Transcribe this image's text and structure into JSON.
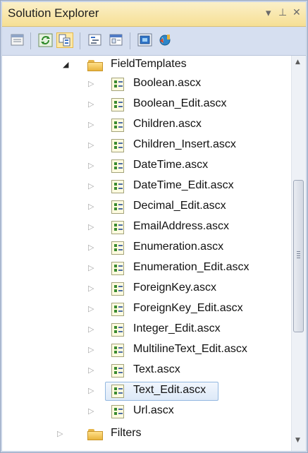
{
  "panel": {
    "title": "Solution Explorer",
    "controls": {
      "dropdown_glyph": "▾",
      "pin_glyph": "⊥",
      "close_glyph": "✕"
    }
  },
  "toolbar": {
    "buttons": [
      {
        "name": "properties-icon"
      },
      {
        "name": "refresh-icon"
      },
      {
        "name": "show-all-files-icon"
      },
      {
        "name": "view-code-icon"
      },
      {
        "name": "view-designer-icon"
      },
      {
        "name": "class-diagram-icon"
      },
      {
        "name": "copy-website-icon"
      }
    ]
  },
  "tree": {
    "folder": {
      "label": "FieldTemplates",
      "expander": "◢",
      "expanded": true
    },
    "files": [
      {
        "label": "Boolean.ascx"
      },
      {
        "label": "Boolean_Edit.ascx"
      },
      {
        "label": "Children.ascx"
      },
      {
        "label": "Children_Insert.ascx"
      },
      {
        "label": "DateTime.ascx"
      },
      {
        "label": "DateTime_Edit.ascx"
      },
      {
        "label": "Decimal_Edit.ascx"
      },
      {
        "label": "EmailAddress.ascx"
      },
      {
        "label": "Enumeration.ascx"
      },
      {
        "label": "Enumeration_Edit.ascx"
      },
      {
        "label": "ForeignKey.ascx"
      },
      {
        "label": "ForeignKey_Edit.ascx"
      },
      {
        "label": "Integer_Edit.ascx"
      },
      {
        "label": "MultilineText_Edit.ascx"
      },
      {
        "label": "Text.ascx"
      },
      {
        "label": "Text_Edit.ascx",
        "selected": true
      },
      {
        "label": "Url.ascx"
      }
    ],
    "collapsed_expander": "▷",
    "next_folder": {
      "label": "Filters",
      "expander": "▷",
      "expanded": false
    }
  },
  "scrollbar": {
    "up_arrow": "▲",
    "down_arrow": "▼"
  },
  "colors": {
    "title_bar": "#f6df94",
    "toolbar": "#d6dff0",
    "selection_border": "#93b8e0"
  }
}
